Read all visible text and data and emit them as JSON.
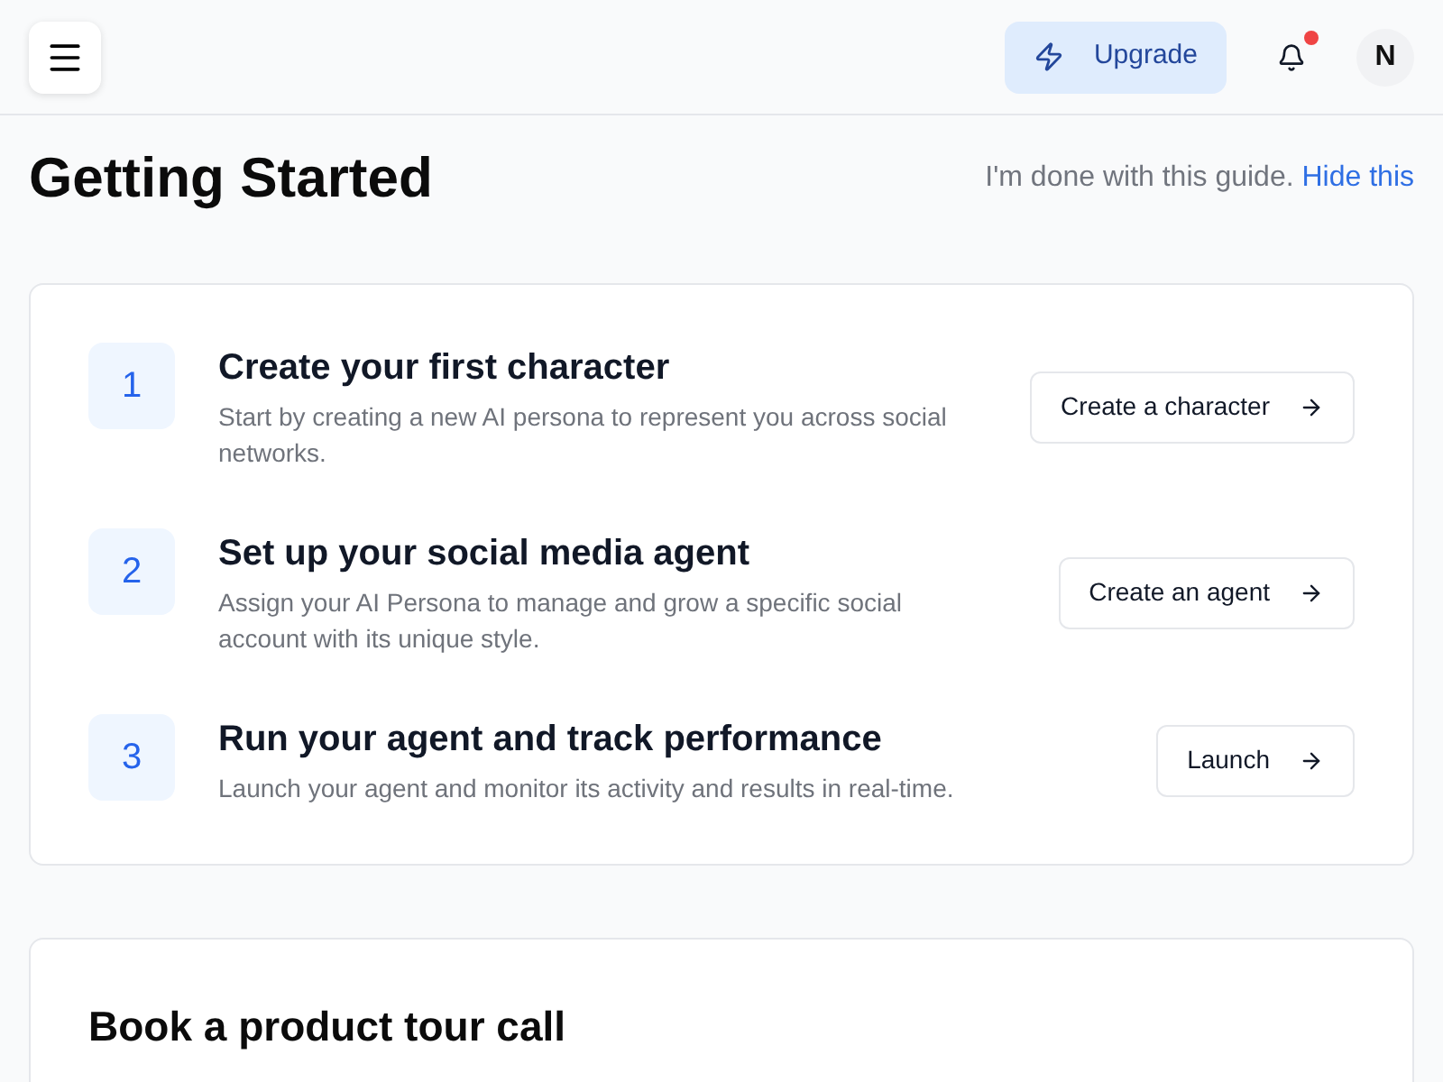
{
  "header": {
    "upgrade_button": "Upgrade",
    "notifications": {
      "unread": true
    },
    "avatar": "N"
  },
  "page": {
    "title": "Getting Started",
    "dismiss_text": "I'm done with this guide.",
    "dismiss_link": "Hide this"
  },
  "steps": [
    {
      "number": "1",
      "title": "Create your first character",
      "description": "Start by creating a new AI persona to represent you across social networks.",
      "action": "Create a character"
    },
    {
      "number": "2",
      "title": "Set up your social media agent",
      "description": "Assign your AI Persona to manage and grow a specific social account with its unique style.",
      "action": "Create an agent"
    },
    {
      "number": "3",
      "title": "Run your agent and track performance",
      "description": "Launch your agent and monitor its activity and results in real-time.",
      "action": "Launch"
    }
  ],
  "tour_card": {
    "title": "Book a product tour call"
  }
}
